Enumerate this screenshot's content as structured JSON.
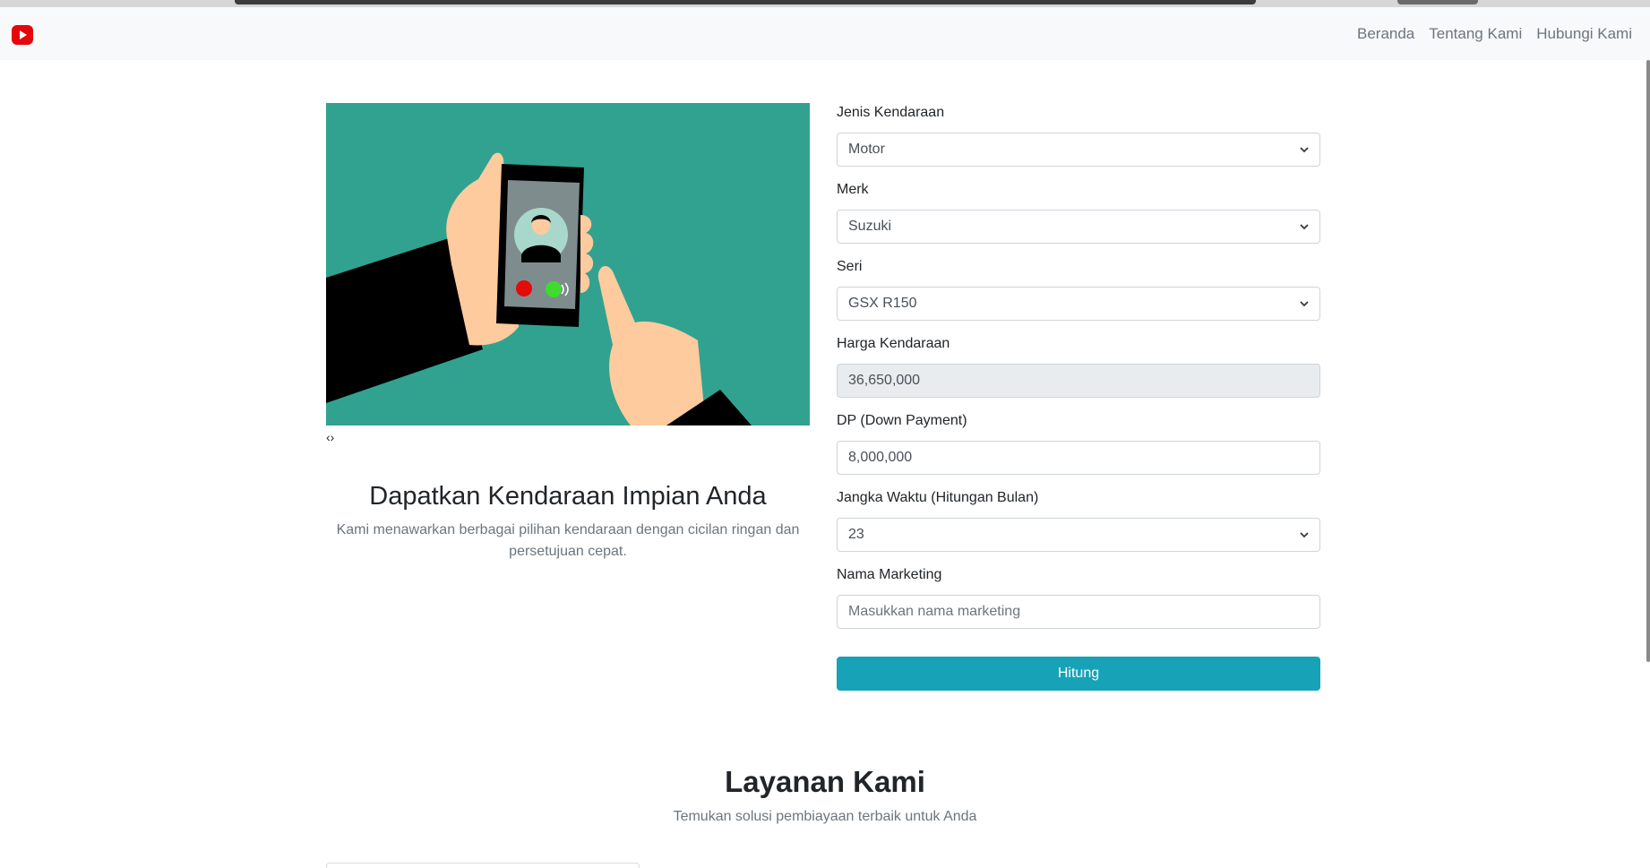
{
  "nav": {
    "logo_icon": "youtube-play-icon",
    "links": [
      "Beranda",
      "Tentang Kami",
      "Hubungi Kami"
    ]
  },
  "hero": {
    "carousel_control": "‹›",
    "title": "Dapatkan Kendaraan Impian Anda",
    "description": "Kami menawarkan berbagai pilihan kendaraan dengan cicilan ringan dan persetujuan cepat."
  },
  "form": {
    "jenis": {
      "label": "Jenis Kendaraan",
      "value": "Motor"
    },
    "merk": {
      "label": "Merk",
      "value": "Suzuki"
    },
    "seri": {
      "label": "Seri",
      "value": "GSX R150"
    },
    "harga": {
      "label": "Harga Kendaraan",
      "value": "36,650,000"
    },
    "dp": {
      "label": "DP (Down Payment)",
      "value": "8,000,000"
    },
    "jangka": {
      "label": "Jangka Waktu (Hitungan Bulan)",
      "value": "23"
    },
    "marketing": {
      "label": "Nama Marketing",
      "placeholder": "Masukkan nama marketing"
    },
    "submit_label": "Hitung"
  },
  "services": {
    "title": "Layanan Kami",
    "subtitle": "Temukan solusi pembiayaan terbaik untuk Anda"
  },
  "colors": {
    "accent": "#17a2b8",
    "hero_bg": "#31a290",
    "logo": "#e3080d"
  }
}
